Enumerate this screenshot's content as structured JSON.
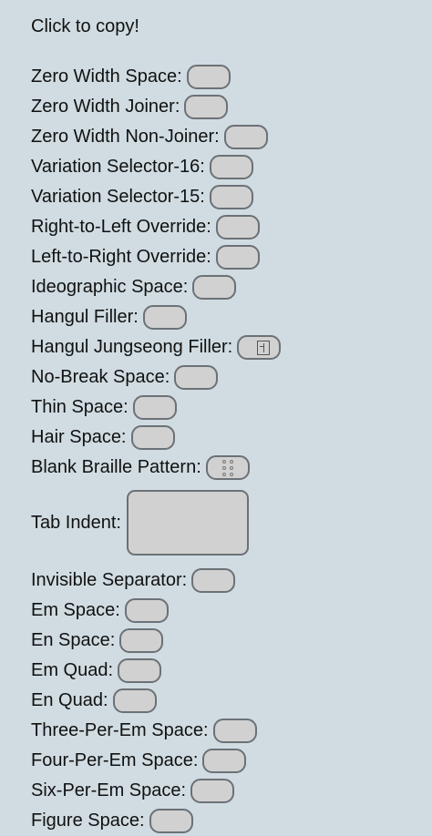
{
  "header": {
    "title": "Click to copy!"
  },
  "items": [
    {
      "label": "Zero Width Space:"
    },
    {
      "label": "Zero Width Joiner:"
    },
    {
      "label": "Zero Width Non-Joiner:"
    },
    {
      "label": "Variation Selector-16:"
    },
    {
      "label": "Variation Selector-15:"
    },
    {
      "label": "Right-to-Left Override:"
    },
    {
      "label": "Left-to-Right Override:"
    },
    {
      "label": "Ideographic Space:"
    },
    {
      "label": "Hangul Filler:"
    },
    {
      "label": "Hangul Jungseong Filler:"
    },
    {
      "label": "No-Break Space:"
    },
    {
      "label": "Thin Space:"
    },
    {
      "label": "Hair Space:"
    },
    {
      "label": "Blank Braille Pattern:"
    },
    {
      "label": "Tab Indent:"
    },
    {
      "label": "Invisible Separator:"
    },
    {
      "label": "Em Space:"
    },
    {
      "label": "En Space:"
    },
    {
      "label": "Em Quad:"
    },
    {
      "label": "En Quad:"
    },
    {
      "label": "Three-Per-Em Space:"
    },
    {
      "label": "Four-Per-Em Space:"
    },
    {
      "label": "Six-Per-Em Space:"
    },
    {
      "label": "Figure Space:"
    }
  ],
  "colors": {
    "background": "#d0dce2",
    "box_fill": "#d1d1d1",
    "box_border": "#6b7176"
  }
}
